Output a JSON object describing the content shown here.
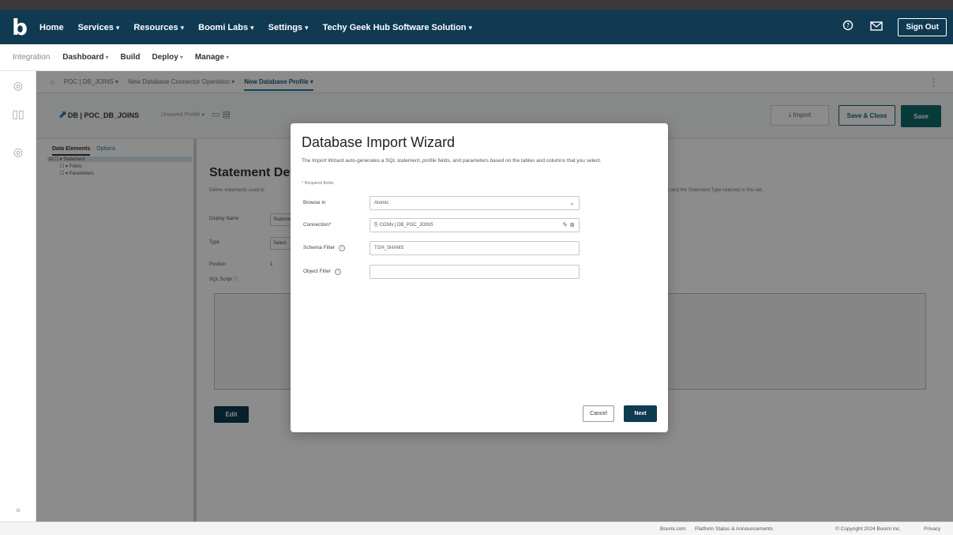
{
  "navbar": {
    "logo": "b",
    "items": [
      {
        "label": "Home",
        "caret": ""
      },
      {
        "label": "Services",
        "caret": "▾"
      },
      {
        "label": "Resources",
        "caret": "▾"
      },
      {
        "label": "Boomi Labs",
        "caret": "▾"
      },
      {
        "label": "Settings",
        "caret": "▾"
      },
      {
        "label": "Techy Geek Hub Software Solution",
        "caret": "▾"
      }
    ],
    "help_icon": "help-circle-icon",
    "mail_icon": "mail-icon",
    "sign_out_label": "Sign Out"
  },
  "subnav": {
    "product": "Integration",
    "items": [
      {
        "label": "Dashboard",
        "caret": "▾"
      },
      {
        "label": "Build",
        "caret": ""
      },
      {
        "label": "Deploy",
        "caret": "▾"
      },
      {
        "label": "Manage",
        "caret": "▾"
      }
    ]
  },
  "breadcrumb": {
    "items": [
      "POC | DB_JOINS ▾",
      "New Database Connector Operation ▾",
      "New Database Profile ▾"
    ],
    "menu_icon": "⋮"
  },
  "component": {
    "name": "DB | POC_DB_JOINS",
    "meta": "Unsaved Profile ●",
    "tools": "▭ ▤",
    "import_label": "⤓ Import",
    "save_close_label": "Save & Close",
    "save_label": "Save"
  },
  "tree": {
    "tabs": [
      "Data Elements",
      "Options"
    ],
    "items": [
      "⊟ ☐ ▾ Statement",
      "☐ ▾ Fields",
      "☐ ▾ Parameters"
    ]
  },
  "main": {
    "title": "Statement Details",
    "description": "Define statements used to",
    "description_right": "tab and the Statement Type selected in this tab.",
    "fields": [
      {
        "label": "Display Name",
        "value": "Statement"
      },
      {
        "label": "Type",
        "value": "Select"
      },
      {
        "label": "Position",
        "value": "1"
      },
      {
        "label": "SQL Script ⓘ",
        "value": ""
      }
    ],
    "edit_label": "Edit"
  },
  "modal": {
    "title": "Database Import Wizard",
    "description": "The Import Wizard auto-generates a SQL statement, profile fields, and parameters based on the tables and columns that you select.",
    "required_note": "* Required fields",
    "browse_label": "Browse in",
    "browse_value": "Atomic",
    "connection_label": "Connection*",
    "connection_value": "⎘ CONN | DB_POC_JOINS",
    "connection_actions": "✎ ⊗",
    "schema_label": "Schema Filter",
    "schema_value": "TGH_SHAMS",
    "object_label": "Object Filter",
    "object_value": "",
    "cancel_label": "Cancel",
    "next_label": "Next"
  },
  "footer": {
    "boomi_link": "Boomi.com",
    "status_link": "Platform Status & Announcements",
    "copyright": "© Copyright 2024 Boomi Inc.",
    "privacy": "Privacy"
  },
  "colors": {
    "navbar": "#0f3a52",
    "accent_teal": "#0f6a6a",
    "overlay": "rgba(0,0,0,0.45)"
  }
}
